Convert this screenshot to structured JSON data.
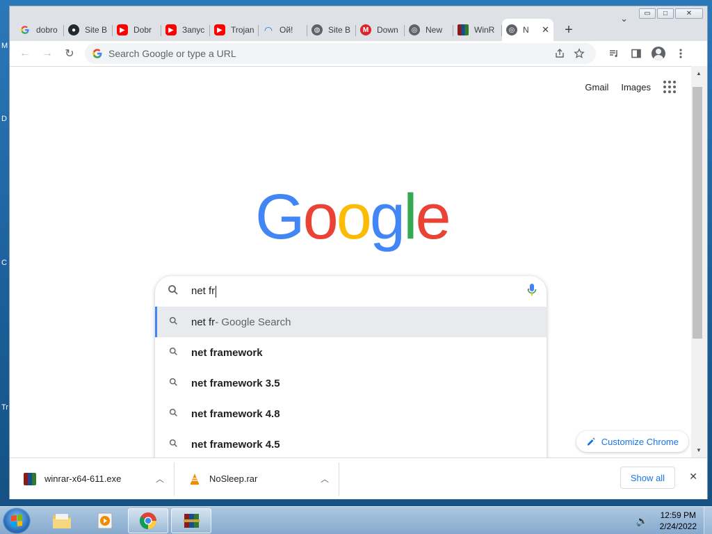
{
  "desktop": {
    "letters": [
      "M",
      "D",
      "C",
      "Tr"
    ]
  },
  "window_controls": {
    "minimize": "▭",
    "maximize": "□",
    "close": "✕"
  },
  "tabs": [
    {
      "label": "dobro",
      "favicon": "google-g-icon"
    },
    {
      "label": "Site B",
      "favicon": "github-icon"
    },
    {
      "label": "Dobr",
      "favicon": "youtube-icon"
    },
    {
      "label": "Запус",
      "favicon": "youtube-icon"
    },
    {
      "label": "Trojan",
      "favicon": "youtube-icon"
    },
    {
      "label": "Ой!",
      "favicon": "edge-icon"
    },
    {
      "label": "Site B",
      "favicon": "globe-icon"
    },
    {
      "label": "Down",
      "favicon": "mega-icon"
    },
    {
      "label": "New",
      "favicon": "chrome-icon"
    },
    {
      "label": "WinR",
      "favicon": "winrar-icon"
    },
    {
      "label": "N",
      "favicon": "chrome-icon",
      "active": true
    }
  ],
  "tab_close": "✕",
  "new_tab": "+",
  "tab_search": "⌄",
  "toolbar": {
    "back": "←",
    "forward": "→",
    "reload": "↻",
    "omnibox_placeholder": "Search Google or type a URL"
  },
  "google": {
    "links": {
      "gmail": "Gmail",
      "images": "Images"
    },
    "logo_letters": [
      "G",
      "o",
      "o",
      "g",
      "l",
      "e"
    ],
    "logo_colors": [
      "#4285f4",
      "#ea4335",
      "#fbbc05",
      "#4285f4",
      "#34a853",
      "#ea4335"
    ],
    "search_query": "net fr",
    "suggestions": [
      {
        "query": "net fr",
        "suffix": " - Google Search",
        "selected": true
      },
      {
        "query": "net framework",
        "suffix": ""
      },
      {
        "query": "net framework 3.5",
        "suffix": ""
      },
      {
        "query": "net framework 4.8",
        "suffix": ""
      },
      {
        "query": "net framework 4.5",
        "suffix": ""
      }
    ],
    "customize_label": "Customize Chrome"
  },
  "downloads": {
    "items": [
      {
        "name": "winrar-x64-611.exe",
        "icon": "winrar-icon"
      },
      {
        "name": "NoSleep.rar",
        "icon": "vlc-icon"
      }
    ],
    "show_all": "Show all",
    "close": "✕"
  },
  "taskbar": {
    "time": "12:59 PM",
    "date": "2/24/2022"
  },
  "colors": {
    "accent": "#1a73e8",
    "selected_suggestion": "#e8eaed"
  }
}
